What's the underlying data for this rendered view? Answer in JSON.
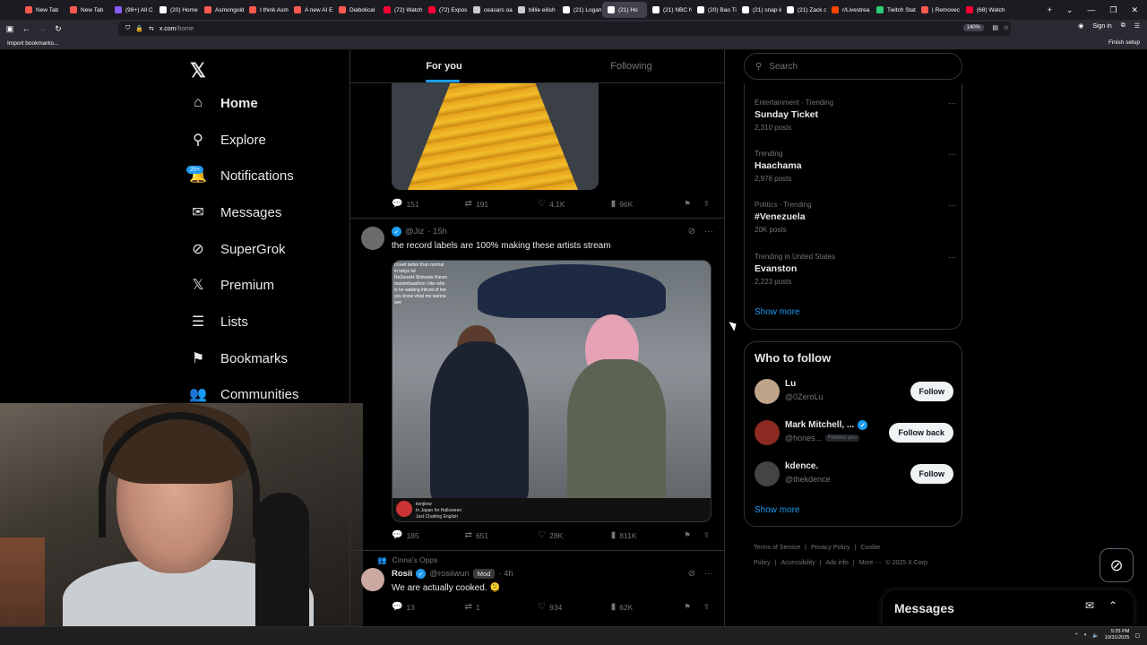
{
  "browser": {
    "tabs": [
      {
        "label": "New Tab",
        "color": "#ff5a4f"
      },
      {
        "label": "New Tab",
        "color": "#ff5a4f"
      },
      {
        "label": "(99+) All C",
        "color": "#8a5cf6"
      },
      {
        "label": "(20) Home",
        "color": "#ffffff"
      },
      {
        "label": "Asmongold",
        "color": "#ff5a4f"
      },
      {
        "label": "I think Asm",
        "color": "#ff5a4f"
      },
      {
        "label": "A new AI E",
        "color": "#ff5a4f"
      },
      {
        "label": "Diabolical",
        "color": "#ff5a4f"
      },
      {
        "label": "(72) Watch",
        "color": "#ff0033"
      },
      {
        "label": "(72) Expos",
        "color": "#ff0033"
      },
      {
        "label": "ceasars oal",
        "color": "#cccccc"
      },
      {
        "label": "billie eilish",
        "color": "#cccccc"
      },
      {
        "label": "(21) Logan",
        "color": "#ffffff"
      },
      {
        "label": "(21) Ho",
        "color": "#ffffff"
      },
      {
        "label": "(21) NBC N",
        "color": "#ffffff"
      },
      {
        "label": "(20) Bao Ti",
        "color": "#ffffff"
      },
      {
        "label": "(21) snap k",
        "color": "#ffffff"
      },
      {
        "label": "(21) Zack o",
        "color": "#ffffff"
      },
      {
        "label": "r/Livestrea",
        "color": "#ff4500"
      },
      {
        "label": "Twitch Stat",
        "color": "#2ecc71"
      },
      {
        "label": "| Removec",
        "color": "#ff5a4f"
      },
      {
        "label": "(68) Watch",
        "color": "#ff0033"
      }
    ],
    "active_tab_index": 13,
    "url_host": "x.com",
    "url_path": "/home",
    "zoom": "140%",
    "import_bookmarks": "Import bookmarks...",
    "sign_in": "Sign in",
    "finish_setup": "Finish setup"
  },
  "sidebar": {
    "logo": "𝕏",
    "notifications_badge": "20+",
    "items": [
      {
        "label": "Home",
        "icon": "home-icon",
        "glyph": "⌂",
        "active": true
      },
      {
        "label": "Explore",
        "icon": "search-icon",
        "glyph": "⚲"
      },
      {
        "label": "Notifications",
        "icon": "bell-icon",
        "glyph": "🔔"
      },
      {
        "label": "Messages",
        "icon": "mail-icon",
        "glyph": "✉"
      },
      {
        "label": "SuperGrok",
        "icon": "grok-icon",
        "glyph": "⊘"
      },
      {
        "label": "Premium",
        "icon": "x-icon",
        "glyph": "𝕏"
      },
      {
        "label": "Lists",
        "icon": "list-icon",
        "glyph": "☰"
      },
      {
        "label": "Bookmarks",
        "icon": "bookmark-icon",
        "glyph": "⚑"
      },
      {
        "label": "Communities",
        "icon": "people-icon",
        "glyph": "👥"
      }
    ]
  },
  "feed": {
    "tabs": [
      "For you",
      "Following"
    ],
    "post1_stats": {
      "replies": "151",
      "reposts": "191",
      "likes": "4.1K",
      "views": "96K"
    },
    "post2": {
      "handle": "@Jiz",
      "time": "· 15h",
      "text": "the record labels are 100% making these artists stream",
      "video_chat": [
        "crowd better than normal",
        "in tokyo lol",
        "ReZerrekt   Shimada Hanzo",
        "masterbaashon  i like who",
        "is he walking infront of her",
        "you know what me wanna",
        "see"
      ],
      "video_strip": [
        "kenjiiew",
        "In Japan for Halloween",
        "Just Chatting  English"
      ],
      "stats": {
        "replies": "185",
        "reposts": "651",
        "likes": "28K",
        "views": "811K"
      }
    },
    "post3": {
      "context": "Cinna's Opps",
      "name": "Rosii",
      "handle": "@rosiiwun",
      "badge": "Mod",
      "time": "· 4h",
      "text": "We are actually cooked. 🫠",
      "stats": {
        "replies": "13",
        "reposts": "1",
        "likes": "934",
        "views": "62K"
      }
    }
  },
  "right": {
    "search_placeholder": "Search",
    "trends": [
      {
        "meta": "Entertainment · Trending",
        "name": "Sunday Ticket",
        "posts": "2,310 posts"
      },
      {
        "meta": "Trending",
        "name": "Haachama",
        "posts": "2,976 posts"
      },
      {
        "meta": "Politics · Trending",
        "name": "#Venezuela",
        "posts": "20K posts"
      },
      {
        "meta": "Trending in United States",
        "name": "Evanston",
        "posts": "2,223 posts"
      }
    ],
    "show_more": "Show more",
    "who_to_follow": {
      "title": "Who to follow",
      "users": [
        {
          "name": "Lu",
          "handle": "@0ZeroLu",
          "button": "Follow",
          "verified": false,
          "follows_you": "",
          "color": "#bfa48a"
        },
        {
          "name": "Mark Mitchell, ...",
          "handle": "@hones...",
          "button": "Follow back",
          "verified": true,
          "follows_you": "Follows you",
          "color": "#8a2a20"
        },
        {
          "name": "kdence.",
          "handle": "@thekdence",
          "button": "Follow",
          "verified": false,
          "follows_you": "",
          "color": "#444444"
        }
      ],
      "show_more": "Show more"
    },
    "footer": [
      "Terms of Service",
      "|",
      "Privacy Policy",
      "|",
      "Cookie Policy",
      "|",
      "Accessibility",
      "|",
      "Ads info",
      "|",
      "More ···",
      "© 2025 X Corp."
    ]
  },
  "messages_dock": {
    "title": "Messages"
  },
  "taskbar": {
    "time": "5:25 PM",
    "date": "10/31/2025"
  }
}
